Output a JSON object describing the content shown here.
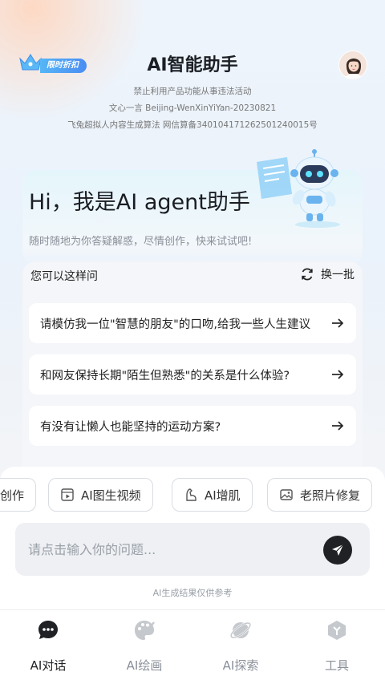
{
  "header": {
    "promo_label": "限时折扣",
    "title": "AI智能助手"
  },
  "notices": {
    "line1": "禁止利用产品功能从事违法活动",
    "line2": "文心一言  Beijing-WenXinYiYan-20230821",
    "line3": "飞兔超拟人内容生成算法  网信算备340104171262501240015号"
  },
  "hero": {
    "title": "Hi，我是AI agent助手",
    "subtitle": "随时随地为你答疑解惑，尽情创作，快来试试吧!"
  },
  "suggestions": {
    "heading": "您可以这样问",
    "refresh_label": "换一批",
    "items": [
      "请模仿我一位\"智慧的朋友\"的口吻,给我一些人生建议",
      "和网友保持长期\"陌生但熟悉\"的关系是什么体验?",
      "有没有让懒人也能坚持的运动方案?"
    ]
  },
  "chips": [
    {
      "label": "创作",
      "icon": "edit-icon"
    },
    {
      "label": "AI图生视频",
      "icon": "video-icon"
    },
    {
      "label": "AI增肌",
      "icon": "muscle-icon"
    },
    {
      "label": "老照片修复",
      "icon": "photo-icon"
    }
  ],
  "input": {
    "placeholder": "请点击输入你的问题..."
  },
  "disclaimer": "AI生成结果仅供参考",
  "tabs": [
    {
      "label": "AI对话",
      "icon": "chat-bubble-icon",
      "active": true
    },
    {
      "label": "AI绘画",
      "icon": "palette-icon",
      "active": false
    },
    {
      "label": "AI探索",
      "icon": "planet-icon",
      "active": false
    },
    {
      "label": "工具",
      "icon": "cube-icon",
      "active": false
    }
  ],
  "colors": {
    "accent": "#4a8cf3",
    "dark": "#1f2124",
    "muted": "#8a8f99"
  }
}
